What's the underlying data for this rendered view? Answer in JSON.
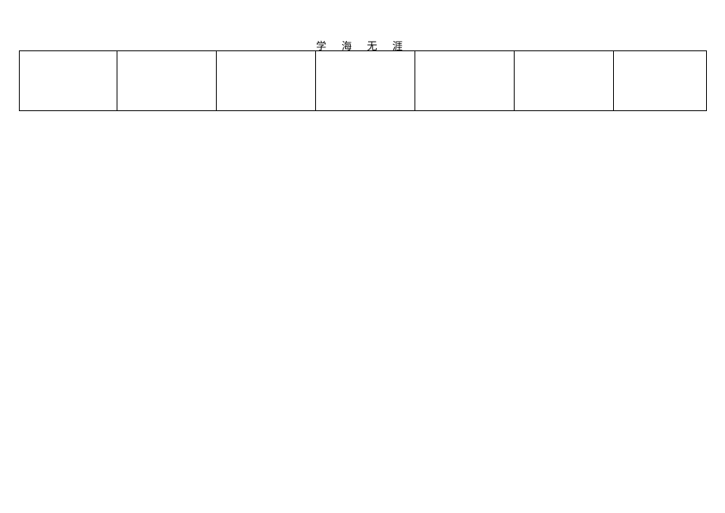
{
  "header": {
    "title": "学 海 无 涯"
  },
  "table": {
    "rows": [
      {
        "cells": [
          "",
          "",
          "",
          "",
          "",
          "",
          ""
        ]
      }
    ]
  }
}
